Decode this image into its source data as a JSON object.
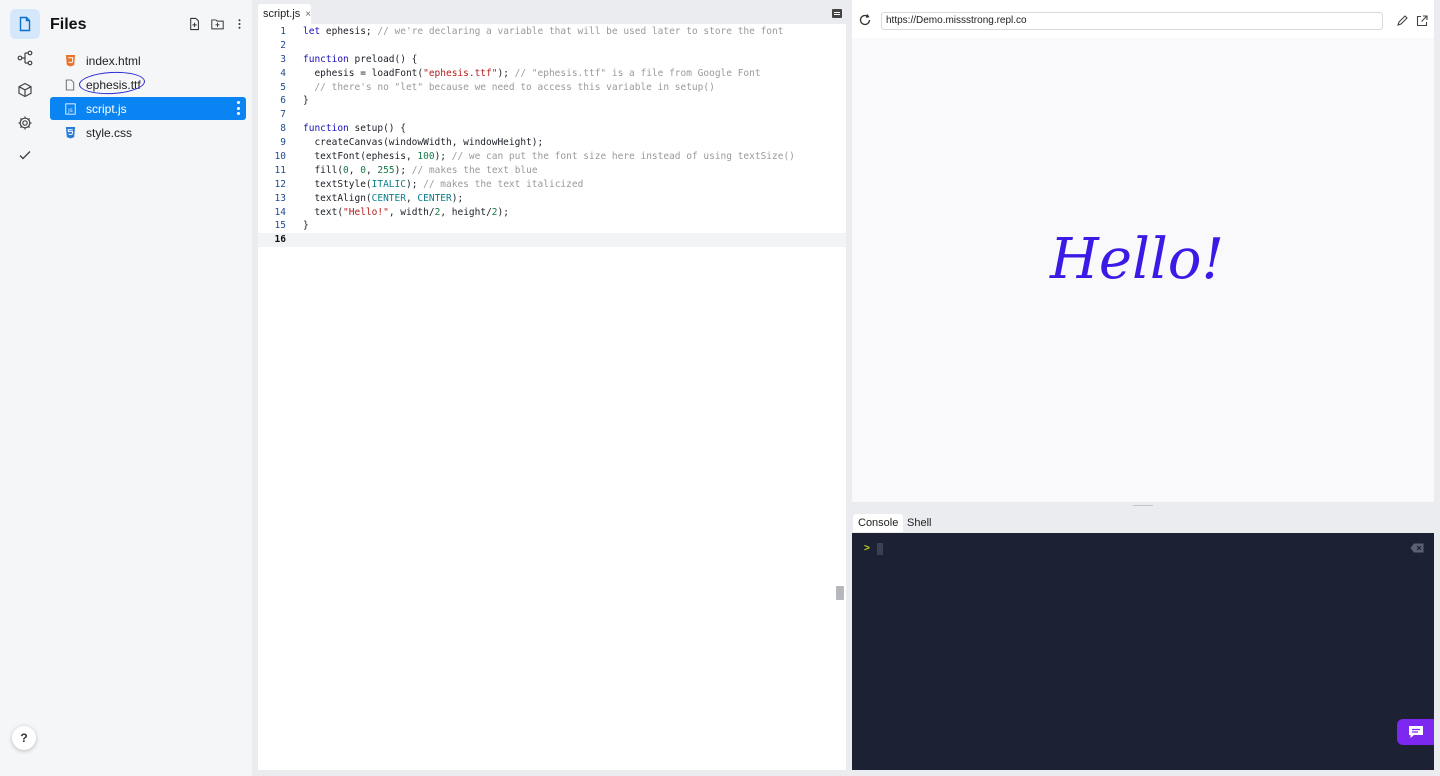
{
  "sidebar": {
    "rail_icons": [
      "files-icon",
      "version-control-icon",
      "packages-icon",
      "settings-icon",
      "checkmark-icon"
    ],
    "help_label": "?"
  },
  "files": {
    "title": "Files",
    "items": [
      {
        "name": "index.html",
        "icon": "html-file-icon",
        "icon_color": "#e8732c"
      },
      {
        "name": "ephesis.ttf",
        "icon": "generic-file-icon",
        "icon_color": "#666666"
      },
      {
        "name": "script.js",
        "icon": "js-file-icon",
        "icon_color": "#ffffff",
        "selected": true
      },
      {
        "name": "style.css",
        "icon": "css-file-icon",
        "icon_color": "#2a7bd8"
      }
    ]
  },
  "editor": {
    "tab_label": "script.js",
    "tab_close": "×",
    "lines": [
      {
        "n": "1",
        "tokens": [
          [
            "k",
            "let"
          ],
          [
            "p",
            " ephesis; "
          ],
          [
            "c",
            "// we're declaring a variable that will be used later to store the font"
          ]
        ]
      },
      {
        "n": "2",
        "tokens": []
      },
      {
        "n": "3",
        "tokens": [
          [
            "k",
            "function"
          ],
          [
            "p",
            " preload() {"
          ]
        ]
      },
      {
        "n": "4",
        "tokens": [
          [
            "p",
            "  ephesis = loadFont("
          ],
          [
            "s",
            "\"ephesis.ttf\""
          ],
          [
            "p",
            "); "
          ],
          [
            "c",
            "// \"ephesis.ttf\" is a file from Google Font"
          ]
        ]
      },
      {
        "n": "5",
        "tokens": [
          [
            "c",
            "  // there's no \"let\" because we need to access this variable in setup()"
          ]
        ]
      },
      {
        "n": "6",
        "tokens": [
          [
            "p",
            "}"
          ]
        ]
      },
      {
        "n": "7",
        "tokens": []
      },
      {
        "n": "8",
        "tokens": [
          [
            "k",
            "function"
          ],
          [
            "p",
            " setup() {"
          ]
        ]
      },
      {
        "n": "9",
        "tokens": [
          [
            "p",
            "  createCanvas(windowWidth, windowHeight);"
          ]
        ]
      },
      {
        "n": "10",
        "tokens": [
          [
            "p",
            "  textFont(ephesis, "
          ],
          [
            "n",
            "100"
          ],
          [
            "p",
            "); "
          ],
          [
            "c",
            "// we can put the font size here instead of using textSize()"
          ]
        ]
      },
      {
        "n": "11",
        "tokens": [
          [
            "p",
            "  fill("
          ],
          [
            "n",
            "0"
          ],
          [
            "p",
            ", "
          ],
          [
            "n",
            "0"
          ],
          [
            "p",
            ", "
          ],
          [
            "n",
            "255"
          ],
          [
            "p",
            "); "
          ],
          [
            "c",
            "// makes the text blue"
          ]
        ]
      },
      {
        "n": "12",
        "tokens": [
          [
            "p",
            "  textStyle("
          ],
          [
            "a",
            "ITALIC"
          ],
          [
            "p",
            "); "
          ],
          [
            "c",
            "// makes the text italicized"
          ]
        ]
      },
      {
        "n": "13",
        "tokens": [
          [
            "p",
            "  textAlign("
          ],
          [
            "a",
            "CENTER"
          ],
          [
            "p",
            ", "
          ],
          [
            "a",
            "CENTER"
          ],
          [
            "p",
            ");"
          ]
        ]
      },
      {
        "n": "14",
        "tokens": [
          [
            "p",
            "  text("
          ],
          [
            "s",
            "\"Hello!\""
          ],
          [
            "p",
            ", width/"
          ],
          [
            "n",
            "2"
          ],
          [
            "p",
            ", height/"
          ],
          [
            "n",
            "2"
          ],
          [
            "p",
            ");"
          ]
        ]
      },
      {
        "n": "15",
        "tokens": [
          [
            "p",
            "}"
          ]
        ]
      },
      {
        "n": "16",
        "tokens": [],
        "current": true
      }
    ]
  },
  "webview": {
    "url": "https://Demo.missstrong.repl.co",
    "output_text": "Hello!",
    "output_color": "#3a1be6"
  },
  "console": {
    "tabs": [
      "Console",
      "Shell"
    ],
    "active_tab": "Console",
    "prompt": ">",
    "background": "#1c2233"
  },
  "colors": {
    "accent": "#0b84f3",
    "chat_button": "#7c28f0"
  }
}
